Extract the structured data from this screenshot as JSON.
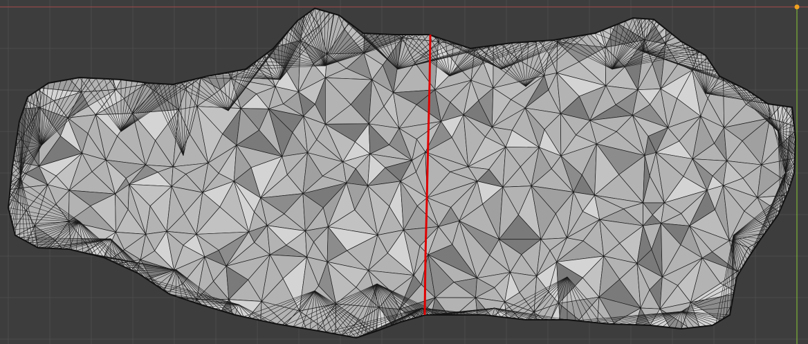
{
  "viewport": {
    "background": "#3d3d3d",
    "grid_color": "#4b4b4b",
    "x_axis_color": "#a84a4a",
    "y_axis_color": "#7eb33a",
    "origin_marker_color": "#f0a020",
    "mesh": {
      "face_color": "#b3b3b3",
      "face_shade_colors": [
        "#a0a0a0",
        "#8c8c8c",
        "#c2c2c2",
        "#d4d4d4",
        "#7a7a7a",
        "#bcbcbc"
      ],
      "wire_color": "#1a1a1a",
      "outline_color": "#111111"
    },
    "selected_edge": {
      "color": "#e00000",
      "label": "selected-edge-loop"
    }
  }
}
